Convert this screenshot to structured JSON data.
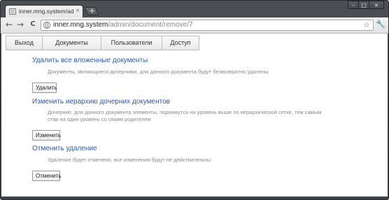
{
  "browser": {
    "tab_title": "inner.mng.system/admin/d...",
    "tab_close": "×",
    "new_tab": "+",
    "window_controls": {
      "minimize": "–",
      "maximize": "□",
      "close": "×"
    },
    "nav": {
      "back": "←",
      "forward": "→",
      "reload": "C"
    },
    "url_host": "inner.mng.system",
    "url_path": "/admin/document/remove/7",
    "bookmark_star": "☆",
    "wrench": "🔧"
  },
  "app_nav": {
    "items": [
      {
        "label": "Выход"
      },
      {
        "label": "Документы"
      },
      {
        "label": "Пользователи"
      },
      {
        "label": "Доступ"
      }
    ]
  },
  "sections": [
    {
      "title": "Удалить все вложенные документы",
      "description": "Документы, являющиеся дочерними, для данного документа будут безвозвратно удалены",
      "button": "Удалить"
    },
    {
      "title": "Изменить иерархию дочерних документов",
      "description": "Дочерние, для данного документа элементы, поднимутся на уровень выше по иерархической сетке, тем самым став на один уровень со своим родителем",
      "button": "Изменить"
    },
    {
      "title": "Отменить удаление",
      "description": "Удаление будет отменено, все изменения будут не действительны",
      "button": "Отменить"
    }
  ],
  "colors": {
    "link_blue": "#2a5ab3",
    "description_gray": "#8a8a8a",
    "frame_dark": "#3e4246"
  }
}
